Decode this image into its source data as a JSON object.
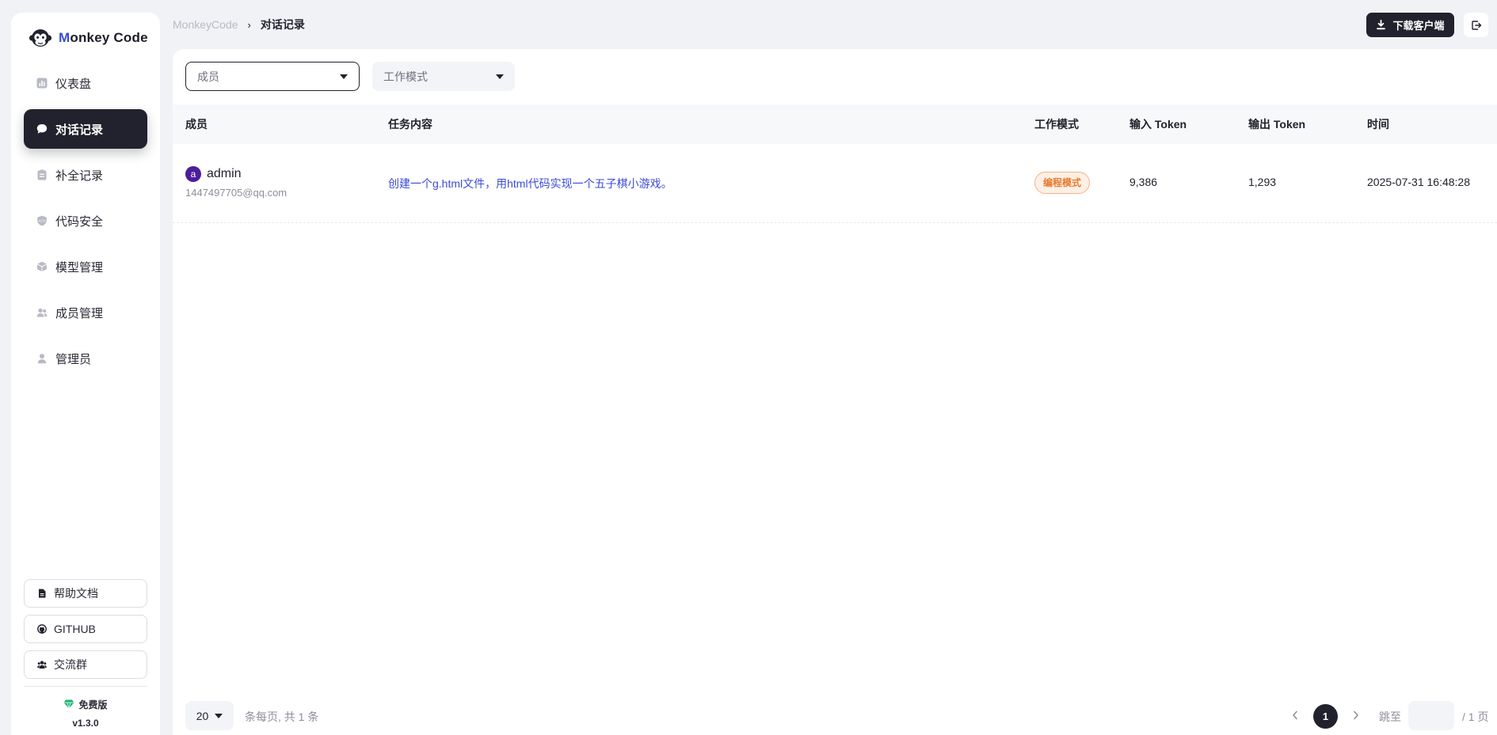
{
  "app": {
    "logo_prefix": "M",
    "logo_rest": "onkey Code"
  },
  "sidebar": {
    "items": [
      {
        "label": "仪表盘",
        "icon": "chart-icon",
        "active": false
      },
      {
        "label": "对话记录",
        "icon": "chat-bubble-icon",
        "active": true
      },
      {
        "label": "补全记录",
        "icon": "clipboard-icon",
        "active": false
      },
      {
        "label": "代码安全",
        "icon": "shield-icon",
        "active": false
      },
      {
        "label": "模型管理",
        "icon": "cube-icon",
        "active": false
      },
      {
        "label": "成员管理",
        "icon": "users-icon",
        "active": false
      },
      {
        "label": "管理员",
        "icon": "user-icon",
        "active": false
      }
    ],
    "bottom_links": [
      {
        "label": "帮助文档",
        "icon": "document-icon"
      },
      {
        "label": "GITHUB",
        "icon": "github-icon"
      },
      {
        "label": "交流群",
        "icon": "group-icon"
      }
    ],
    "plan": "免费版",
    "version": "v1.3.0"
  },
  "breadcrumb": {
    "root": "MonkeyCode",
    "separator": "›",
    "current": "对话记录"
  },
  "header": {
    "download_label": "下载客户端"
  },
  "filters": {
    "member_placeholder": "成员",
    "mode_placeholder": "工作模式"
  },
  "table": {
    "columns": [
      "成员",
      "任务内容",
      "工作模式",
      "输入 Token",
      "输出 Token",
      "时间"
    ],
    "rows": [
      {
        "avatar_letter": "a",
        "member_name": "admin",
        "member_email": "1447497705@qq.com",
        "task": "创建一个g.html文件，用html代码实现一个五子棋小游戏。",
        "mode": "编程模式",
        "input_token": "9,386",
        "output_token": "1,293",
        "time": "2025-07-31 16:48:28"
      }
    ]
  },
  "pagination": {
    "page_size": "20",
    "info": "条每页, 共 1 条",
    "current_page": "1",
    "jump_label": "跳至",
    "total_pages": "/ 1 页"
  },
  "colors": {
    "accent_dark": "#21222d",
    "link_blue": "#3b4bd8",
    "tag_orange": "#e67a2e",
    "avatar_purple": "#4b1f9c"
  }
}
